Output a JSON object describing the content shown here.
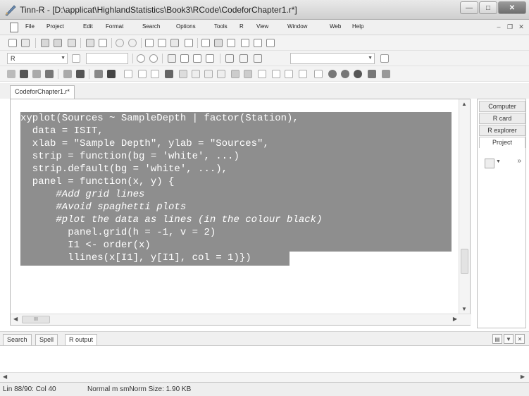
{
  "window": {
    "title": "Tinn-R - [D:\\applicat\\HighlandStatistics\\Book3\\RCode\\CodeforChapter1.r*]"
  },
  "menu": {
    "items": [
      "File",
      "Project",
      "Edit",
      "Format",
      "Search",
      "Options",
      "Tools",
      "R",
      "View",
      "Window",
      "Web",
      "Help"
    ]
  },
  "toolbar": {
    "syntax_combo": "R"
  },
  "editor": {
    "tab_label": "CodeforChapter1.r*",
    "code_lines": [
      "xyplot(Sources ~ SampleDepth | factor(Station),",
      "  data = ISIT,",
      "  xlab = \"Sample Depth\", ylab = \"Sources\",",
      "  strip = function(bg = 'white', ...)",
      "  strip.default(bg = 'white', ...),",
      "  panel = function(x, y) {",
      "      #Add grid lines",
      "      #Avoid spaghetti plots",
      "      #plot the data as lines (in the colour black)",
      "        panel.grid(h = -1, v = 2)",
      "        I1 <- order(x)",
      "        llines(x[I1], y[I1], col = 1)})"
    ],
    "hscroll_label": "III"
  },
  "right_panel": {
    "tabs": [
      "Computer",
      "R card",
      "R explorer",
      "Project"
    ]
  },
  "bottom_tabs": [
    "Search",
    "Spell",
    "R output"
  ],
  "status": {
    "position": "Lin 88/90: Col 40",
    "mode": "Normal m smNorm Size: 1.90 KB"
  },
  "colors": {
    "selection": "#8e8e8e",
    "code_text": "#ffffff"
  }
}
